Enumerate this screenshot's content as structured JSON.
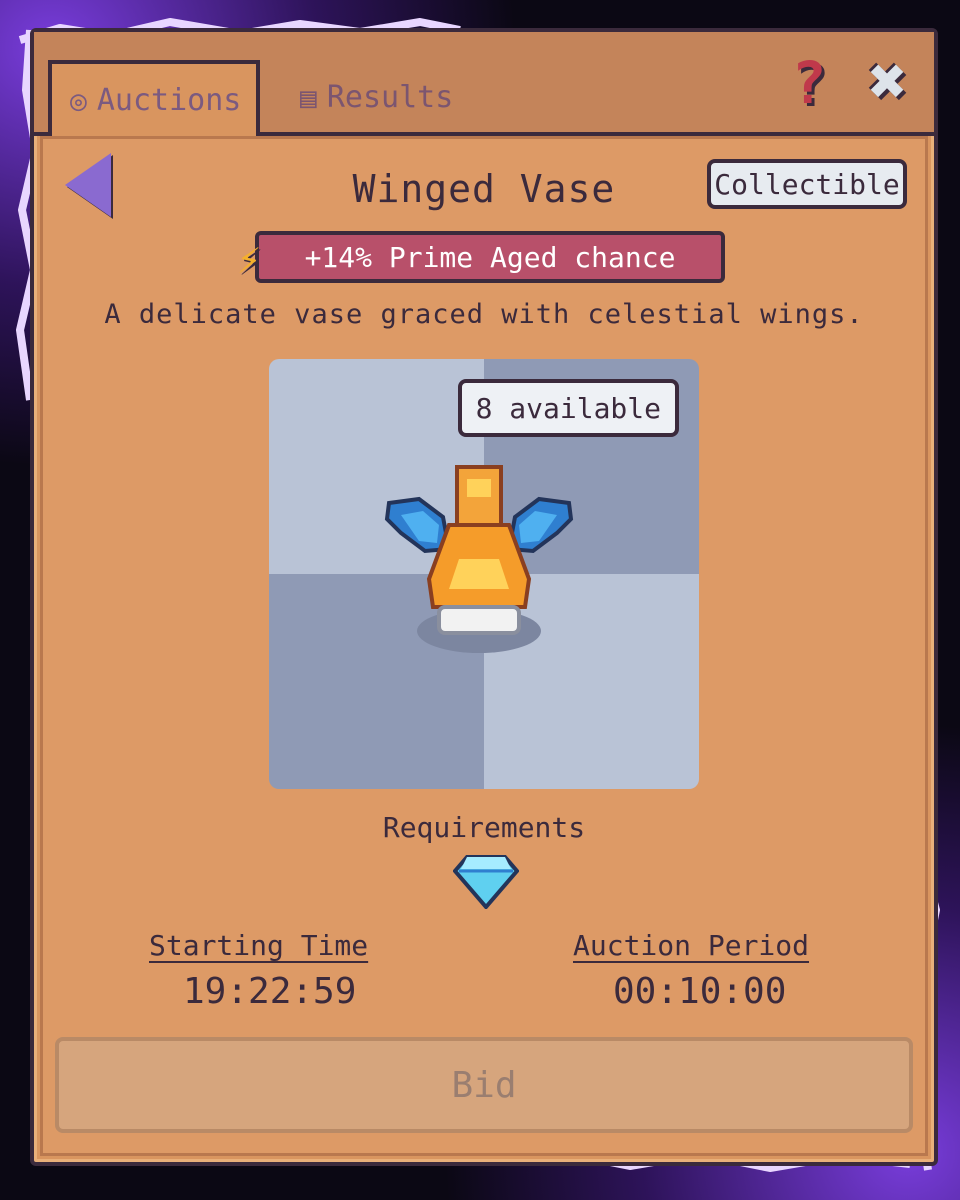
{
  "tabs": {
    "auctions_label": "Auctions",
    "results_label": "Results"
  },
  "header": {
    "help_icon": "question-icon",
    "close_icon": "close-icon",
    "help_glyph": "?",
    "close_glyph": "✖"
  },
  "item": {
    "title": "Winged Vase",
    "category_badge": "Collectible",
    "boost_text": "+14% Prime Aged chance",
    "description": "A delicate vase graced with celestial wings.",
    "available_text": "8 available"
  },
  "requirements": {
    "label": "Requirements",
    "icon": "diamond-gem-icon"
  },
  "stats": {
    "starting_time_label": "Starting Time",
    "starting_time_value": "19:22:59",
    "auction_period_label": "Auction Period",
    "auction_period_value": "00:10:00"
  },
  "actions": {
    "bid_label": "Bid"
  },
  "colors": {
    "panel": "#d9955f",
    "outline": "#3b2a3c",
    "boost_bg": "#b8506a",
    "glow": "#8c46ff"
  }
}
